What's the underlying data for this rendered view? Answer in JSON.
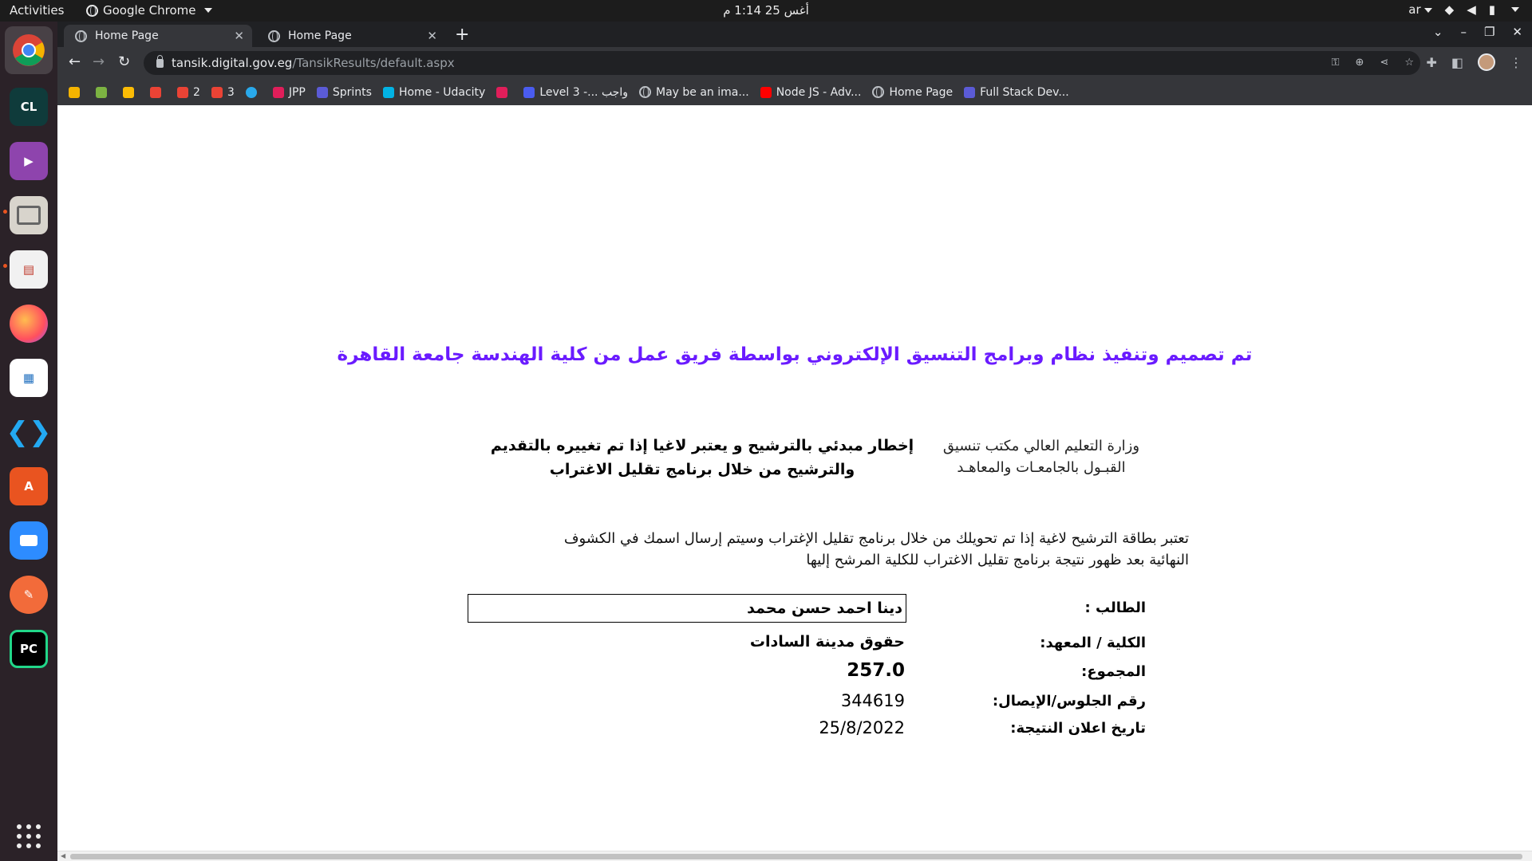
{
  "system": {
    "activities": "Activities",
    "app_name": "Google Chrome",
    "clock": "أغس 25  1:14 م",
    "lang": "ar"
  },
  "dock": {
    "items": [
      {
        "name": "chrome-icon",
        "label": ""
      },
      {
        "name": "clion-icon",
        "label": "CL"
      },
      {
        "name": "video-player-icon",
        "label": "▶"
      },
      {
        "name": "files-icon",
        "label": ""
      },
      {
        "name": "document-viewer-icon",
        "label": ""
      },
      {
        "name": "firefox-icon",
        "label": ""
      },
      {
        "name": "writer-icon",
        "label": ""
      },
      {
        "name": "vscode-icon",
        "label": ""
      },
      {
        "name": "software-center-icon",
        "label": "A"
      },
      {
        "name": "zoom-icon",
        "label": ""
      },
      {
        "name": "color-picker-icon",
        "label": ""
      },
      {
        "name": "pycharm-icon",
        "label": "PC"
      }
    ]
  },
  "browser": {
    "tabs": [
      {
        "label": "Home Page",
        "active": true
      },
      {
        "label": "Home Page",
        "active": false
      }
    ],
    "url_host": "tansik.digital.gov.eg",
    "url_path": "/TansikResults/default.aspx",
    "bookmarks": [
      {
        "label": "",
        "color": "#f4b400"
      },
      {
        "label": "",
        "color": "#7cb342"
      },
      {
        "label": "",
        "color": "#fbbc05"
      },
      {
        "label": "",
        "color": "#ea4335"
      },
      {
        "label": "2",
        "color": "#ea4335"
      },
      {
        "label": "3",
        "color": "#ea4335"
      },
      {
        "label": "",
        "color": "#29a9eb"
      },
      {
        "label": "JPP",
        "color": "#e01e5a"
      },
      {
        "label": "Sprints",
        "color": "#5b5bd6"
      },
      {
        "label": "Home - Udacity",
        "color": "#02b3e4"
      },
      {
        "label": "",
        "color": "#e01e5a"
      },
      {
        "label": "Level 3 -... واجب",
        "color": "#4a5cf0"
      },
      {
        "label": "May be an ima...",
        "color": "#e8eaed"
      },
      {
        "label": "Node JS - Adv...",
        "color": "#ff0000"
      },
      {
        "label": "Home Page",
        "color": "#e8eaed"
      },
      {
        "label": "Full Stack Dev...",
        "color": "#5b5bd6"
      }
    ]
  },
  "page": {
    "headline": "تم تصميم وتنفيذ نظام وبرامج التنسيق الإلكتروني بواسطة فريق عمل من كلية الهندسة جامعة القاهرة",
    "ministry_line1": "وزارة التعليم العالي مكتب تنسيق",
    "ministry_line2": "القبـول بالجامعـات والمعاهـد",
    "notice_line1": "إخطار مبدئي بالترشيح و يعتبر لاغيا إذا تم تغييره بالتقديم",
    "notice_line2": "والترشيح من خلال برنامج تقليل الاغتراب",
    "warning_line1": "تعتبر بطاقة الترشيح لاغية إذا تم تحويلك من خلال برنامج تقليل الإغتراب وسيتم إرسال اسمك في الكشوف",
    "warning_line2": "النهائية بعد ظهور نتيجة برنامج تقليل الاغتراب للكلية المرشح إليها",
    "student_label": "الطالب :",
    "student_value": "دينا احمد حسن محمد",
    "faculty_label": "الكلية / المعهد:",
    "faculty_value": "حقوق مدينة السادات",
    "total_label": "المجموع:",
    "total_value": "257.0",
    "seat_label": "رقم الجلوس/الإيصال:",
    "seat_value": "344619",
    "date_label": "تاريخ اعلان النتيجة:",
    "date_value": "25/8/2022"
  }
}
